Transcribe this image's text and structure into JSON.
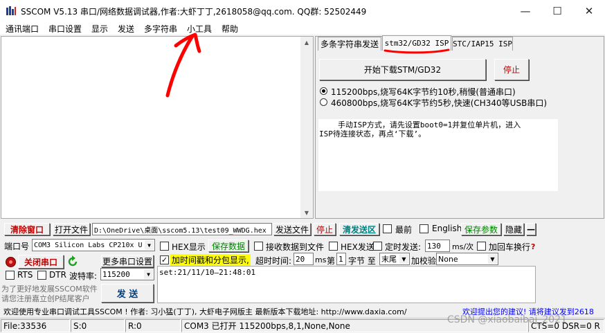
{
  "window": {
    "title": "SSCOM V5.13 串口/网络数据调试器,作者:大虾丁丁,2618058@qq.com. QQ群: 52502449",
    "minimize_glyph": "—",
    "maximize_glyph": "☐",
    "close_glyph": "✕"
  },
  "menu": [
    "通讯端口",
    "串口设置",
    "显示",
    "发送",
    "多字符串",
    "小工具",
    "帮助"
  ],
  "receive": {
    "text": ""
  },
  "tabs": [
    "多条字符串发送",
    "stm32/GD32 ISP",
    "STC/IAP15 ISP"
  ],
  "isp": {
    "start_button": "开始下载STM/GD32",
    "stop_button": "停止",
    "baud_options": [
      "115200bps,烧写64K字节约10秒,稍慢(普通串口)",
      "460800bps,烧写64K字节约5秒,快速(CH340等USB串口)"
    ],
    "hint_line1": "手动ISP方式，请先设置boot0=1并复位单片机，进入",
    "hint_line2": "ISP待连接状态，再点‘下载’。"
  },
  "toolbar": {
    "clear_button": "清除窗口",
    "open_file_button": "打开文件",
    "file_path": "D:\\OneDrive\\桌面\\sscom5.13\\test09_WWDG.hex",
    "send_file_button": "发送文件",
    "stop_button": "停止",
    "clear_send_button": "清发送区",
    "front_label": "最前",
    "english_label": "English",
    "save_params_button": "保存参数",
    "hide_button": "隐藏",
    "collapse_glyph": "—"
  },
  "port": {
    "port_label": "端口号",
    "port_value": "COM3 Silicon Labs CP210x U",
    "close_port_button": "关闭串口",
    "more_settings_button": "更多串口设置",
    "rts_label": "RTS",
    "dtr_label": "DTR",
    "baud_label": "波特率:",
    "baud_value": "115200",
    "promo_line1": "为了更好地发展SSCOM软件",
    "promo_line2": "请您注册嘉立创P结尾客户",
    "send_button": "发 送"
  },
  "options": {
    "hex_display_label": "HEX显示",
    "save_data_button": "保存数据",
    "recv_to_file_label": "接收数据到文件",
    "hex_send_label": "HEX发送",
    "timed_send_label": "定时发送:",
    "timed_value": "130",
    "timed_unit": "ms/次",
    "add_crlf_label": "加回车换行",
    "help_glyph": "?",
    "timestamp_label": "加时间戳和分包显示,",
    "timeout_label": "超时时间:",
    "timeout_value": "20",
    "timeout_unit": "ms",
    "byte_prefix": "第",
    "byte_from": "1",
    "byte_mid": "字节 至",
    "byte_to": "末尾",
    "checksum_label": "加校验",
    "checksum_value": "None"
  },
  "send_text": "set:21/11/10—21:48:01",
  "promo_bar": {
    "text": "欢迎使用专业串口调试工具SSCOM ! 作者: 习小猛(丁丁), 大虾电子网版主 最新版本下载地址: http://www.daxia.com/",
    "link": "欢迎提出您的建议! 请将建议发到2618"
  },
  "status": {
    "file": "File:33536",
    "sent": "S:0",
    "received": "R:0",
    "port_state": "COM3 已打开 115200bps,8,1,None,None",
    "signals": "CTS=0 DSR=0 R"
  },
  "watermark": "CSDN @xiaobaibai_2021",
  "colors": {
    "accent_red": "#ff0000",
    "highlight_yellow": "#ffff00",
    "label_green": "#008000",
    "link_blue": "#0000ff",
    "title_red": "#c00000"
  }
}
